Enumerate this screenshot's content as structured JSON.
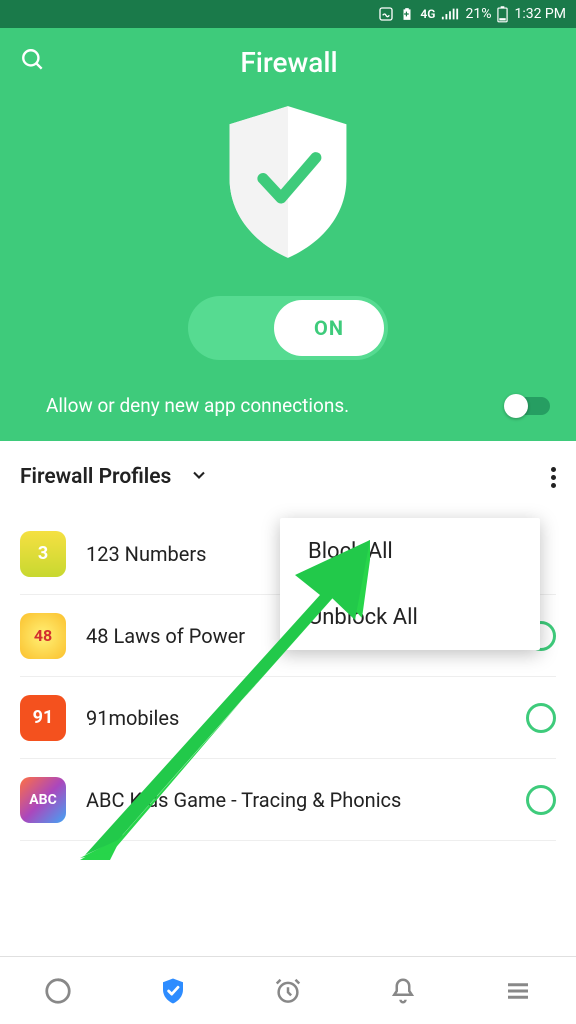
{
  "status_bar": {
    "network_label": "4G",
    "battery_pct": "21%",
    "time": "1:32 PM"
  },
  "header": {
    "title": "Firewall",
    "main_toggle_label": "ON",
    "allow_label": "Allow or deny new app connections."
  },
  "profiles": {
    "title": "Firewall Profiles"
  },
  "popup": {
    "items": [
      "Block All",
      "Unblock All"
    ]
  },
  "apps": [
    {
      "name": "123 Numbers",
      "icon_text": "3",
      "icon_class": "ic-123"
    },
    {
      "name": "48 Laws of Power",
      "icon_text": "48",
      "icon_class": "ic-48"
    },
    {
      "name": "91mobiles",
      "icon_text": "91",
      "icon_class": "ic-91"
    },
    {
      "name": "ABC Kids Game - Tracing & Phonics",
      "icon_text": "ABC",
      "icon_class": "ic-abc"
    }
  ],
  "nav": {
    "items": [
      "data-usage",
      "firewall",
      "clock",
      "notifications",
      "menu"
    ]
  }
}
